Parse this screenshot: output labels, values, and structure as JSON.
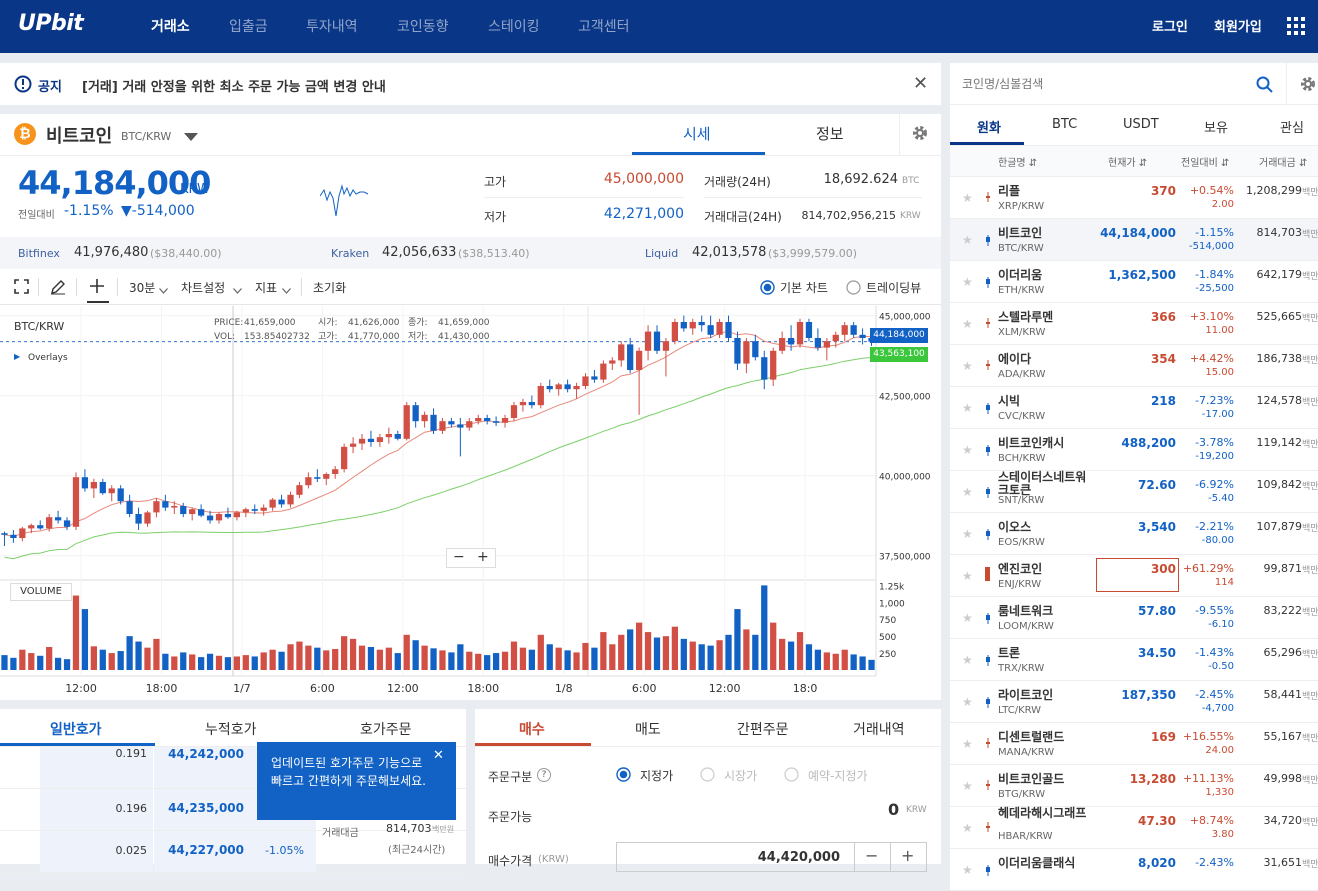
{
  "header": {
    "logo": "UPbit",
    "nav": [
      "거래소",
      "입출금",
      "투자내역",
      "코인동향",
      "스테이킹",
      "고객센터"
    ],
    "login": "로그인",
    "signup": "회원가입"
  },
  "notice": {
    "label": "공지",
    "text": "[거래] 거래 안정을 위한 최소 주문 가능 금액 변경 안내"
  },
  "coin": {
    "name": "비트코인",
    "pair": "BTC/KRW",
    "tab_price": "시세",
    "tab_info": "정보",
    "price": "44,184,000",
    "currency": "KRW",
    "prev_label": "전일대비",
    "change_pct": "-1.15%",
    "change_val": "▼-514,000",
    "high_label": "고가",
    "high": "45,000,000",
    "low_label": "저가",
    "low": "42,271,000",
    "vol_label": "거래량(24H)",
    "vol": "18,692.624",
    "vol_unit": "BTC",
    "amt_label": "거래대금(24H)",
    "amt": "814,702,956,215",
    "amt_unit": "KRW"
  },
  "exchanges": [
    {
      "name": "Bitfinex",
      "price": "41,976,480",
      "usd": "($38,440.00)"
    },
    {
      "name": "Kraken",
      "price": "42,056,633",
      "usd": "($38,513.40)"
    },
    {
      "name": "Liquid",
      "price": "42,013,578",
      "usd": "($3,999,579.00)"
    }
  ],
  "chart_toolbar": {
    "interval": "30분",
    "settings": "차트설정",
    "indicator": "지표",
    "reset": "초기화",
    "basic_chart": "기본 차트",
    "tradingview": "트레이딩뷰"
  },
  "chart_info": {
    "symbol": "BTC/KRW",
    "overlays": "Overlays",
    "price_label": "PRICE:",
    "price_val": "41,659,000",
    "vol_label": "VOL:",
    "vol_val": "153.85402732",
    "open_label": "시가:",
    "open_val": "41,626,000",
    "high_label": "고가:",
    "high_val": "41,770,000",
    "close_label": "종가:",
    "close_val": "41,659,000",
    "low_label": "저가:",
    "low_val": "41,430,000",
    "volume_label": "VOLUME",
    "cur_price_tag": "44,184,000",
    "ma_tag": "43,563,100"
  },
  "chart_data": {
    "type": "candlestick",
    "y_ticks": [
      "45,000,000",
      "42,500,000",
      "40,000,000",
      "37,500,000"
    ],
    "vol_ticks": [
      "1.25k",
      "1,000",
      "750",
      "500",
      "250"
    ],
    "x_ticks": [
      "12:00",
      "18:00",
      "1/7",
      "6:00",
      "12:00",
      "18:00",
      "1/8",
      "6:00",
      "12:00",
      "18:0"
    ],
    "ylim": [
      36800000,
      45300000
    ],
    "vol_max": 1300,
    "candles": [
      [
        38200000,
        38250000,
        37800000,
        38150000,
        220
      ],
      [
        38150000,
        38300000,
        37900000,
        38050000,
        180
      ],
      [
        38050000,
        38400000,
        37950000,
        38350000,
        300
      ],
      [
        38350000,
        38500000,
        38200000,
        38450000,
        250
      ],
      [
        38450000,
        38600000,
        38300000,
        38350000,
        210
      ],
      [
        38350000,
        38800000,
        38250000,
        38700000,
        340
      ],
      [
        38700000,
        38900000,
        38500000,
        38600000,
        180
      ],
      [
        38600000,
        38700000,
        38300000,
        38400000,
        160
      ],
      [
        38400000,
        40100000,
        38300000,
        39950000,
        1100
      ],
      [
        39950000,
        40200000,
        39500000,
        39600000,
        900
      ],
      [
        39600000,
        39900000,
        39300000,
        39800000,
        350
      ],
      [
        39800000,
        39900000,
        39400000,
        39450000,
        300
      ],
      [
        39450000,
        39700000,
        39200000,
        39600000,
        250
      ],
      [
        39600000,
        39700000,
        39100000,
        39200000,
        280
      ],
      [
        39200000,
        39400000,
        38700000,
        38800000,
        500
      ],
      [
        38800000,
        39000000,
        38300000,
        38500000,
        420
      ],
      [
        38500000,
        38900000,
        38400000,
        38850000,
        330
      ],
      [
        38850000,
        39300000,
        38700000,
        39200000,
        460
      ],
      [
        39200000,
        39400000,
        38900000,
        39000000,
        240
      ],
      [
        39000000,
        39200000,
        38800000,
        39050000,
        200
      ],
      [
        39050000,
        39150000,
        38700000,
        38800000,
        260
      ],
      [
        38800000,
        39000000,
        38600000,
        38950000,
        230
      ],
      [
        38950000,
        39100000,
        38700000,
        38750000,
        190
      ],
      [
        38750000,
        38900000,
        38500000,
        38600000,
        240
      ],
      [
        38600000,
        38850000,
        38500000,
        38800000,
        210
      ],
      [
        38800000,
        39000000,
        38650000,
        38700000,
        190
      ],
      [
        38700000,
        38900000,
        38600000,
        38850000,
        200
      ],
      [
        38850000,
        39000000,
        38700000,
        38950000,
        220
      ],
      [
        38950000,
        39100000,
        38800000,
        38900000,
        200
      ],
      [
        38900000,
        39100000,
        38750000,
        39000000,
        260
      ],
      [
        39000000,
        39300000,
        38900000,
        39250000,
        300
      ],
      [
        39250000,
        39400000,
        39000000,
        39100000,
        270
      ],
      [
        39100000,
        39500000,
        39000000,
        39400000,
        380
      ],
      [
        39400000,
        39800000,
        39300000,
        39700000,
        420
      ],
      [
        39700000,
        40100000,
        39600000,
        39950000,
        360
      ],
      [
        39950000,
        40200000,
        39800000,
        39900000,
        330
      ],
      [
        39900000,
        40100000,
        39700000,
        40050000,
        290
      ],
      [
        40050000,
        40300000,
        39900000,
        40200000,
        310
      ],
      [
        40200000,
        41000000,
        40100000,
        40900000,
        500
      ],
      [
        40900000,
        41200000,
        40700000,
        41000000,
        460
      ],
      [
        41000000,
        41300000,
        40800000,
        41150000,
        360
      ],
      [
        41150000,
        41400000,
        40900000,
        41050000,
        340
      ],
      [
        41050000,
        41300000,
        40900000,
        41200000,
        300
      ],
      [
        41200000,
        41500000,
        41000000,
        41300000,
        330
      ],
      [
        41300000,
        41400000,
        41100000,
        41150000,
        250
      ],
      [
        41150000,
        42300000,
        41100000,
        42200000,
        520
      ],
      [
        42200000,
        42300000,
        41500000,
        41700000,
        440
      ],
      [
        41700000,
        42000000,
        41500000,
        41900000,
        360
      ],
      [
        41900000,
        42100000,
        41300000,
        41400000,
        320
      ],
      [
        41400000,
        41800000,
        41300000,
        41700000,
        290
      ],
      [
        41700000,
        41800000,
        41500000,
        41600000,
        260
      ],
      [
        41600000,
        41800000,
        40600000,
        41500000,
        380
      ],
      [
        41500000,
        41800000,
        41400000,
        41700000,
        270
      ],
      [
        41700000,
        41900000,
        41600000,
        41800000,
        240
      ],
      [
        41800000,
        41900000,
        41600000,
        41700000,
        220
      ],
      [
        41700000,
        41850000,
        41550000,
        41650000,
        250
      ],
      [
        41650000,
        41900000,
        41500000,
        41800000,
        270
      ],
      [
        41800000,
        42300000,
        41700000,
        42200000,
        420
      ],
      [
        42200000,
        42400000,
        42000000,
        42300000,
        330
      ],
      [
        42300000,
        42500000,
        42100000,
        42200000,
        300
      ],
      [
        42200000,
        42900000,
        42100000,
        42800000,
        520
      ],
      [
        42800000,
        43000000,
        42600000,
        42700000,
        380
      ],
      [
        42700000,
        42900000,
        42500000,
        42850000,
        330
      ],
      [
        42850000,
        43000000,
        42600000,
        42700000,
        290
      ],
      [
        42700000,
        42900000,
        42400000,
        42800000,
        260
      ],
      [
        42800000,
        43200000,
        42700000,
        43100000,
        400
      ],
      [
        43100000,
        43300000,
        42900000,
        43000000,
        330
      ],
      [
        43000000,
        43600000,
        42900000,
        43500000,
        560
      ],
      [
        43500000,
        43700000,
        43300000,
        43600000,
        380
      ],
      [
        43600000,
        44200000,
        43400000,
        44100000,
        520
      ],
      [
        44100000,
        44300000,
        43200000,
        43300000,
        600
      ],
      [
        43300000,
        44000000,
        41900000,
        43900000,
        700
      ],
      [
        43900000,
        44700000,
        43600000,
        44500000,
        560
      ],
      [
        44500000,
        44700000,
        43800000,
        43900000,
        480
      ],
      [
        43900000,
        44300000,
        43100000,
        44200000,
        500
      ],
      [
        44200000,
        44900000,
        44100000,
        44800000,
        640
      ],
      [
        44800000,
        45000000,
        44500000,
        44600000,
        460
      ],
      [
        44600000,
        44900000,
        44400000,
        44800000,
        420
      ],
      [
        44800000,
        45000000,
        44500000,
        44700000,
        380
      ],
      [
        44700000,
        45000000,
        44300000,
        44400000,
        360
      ],
      [
        44400000,
        44900000,
        44300000,
        44800000,
        440
      ],
      [
        44800000,
        45000000,
        44200000,
        44300000,
        520
      ],
      [
        44300000,
        44500000,
        43300000,
        43500000,
        900
      ],
      [
        43500000,
        44300000,
        43200000,
        44200000,
        600
      ],
      [
        44200000,
        44400000,
        43600000,
        43700000,
        520
      ],
      [
        43700000,
        43900000,
        42700000,
        43000000,
        1250
      ],
      [
        43000000,
        44000000,
        42800000,
        43900000,
        700
      ],
      [
        43900000,
        44500000,
        43800000,
        44300000,
        460
      ],
      [
        44300000,
        44700000,
        43900000,
        44100000,
        420
      ],
      [
        44100000,
        44900000,
        44000000,
        44800000,
        560
      ],
      [
        44800000,
        44900000,
        44200000,
        44300000,
        380
      ],
      [
        44300000,
        44600000,
        43900000,
        44000000,
        300
      ],
      [
        44000000,
        44300000,
        43600000,
        44200000,
        260
      ],
      [
        44200000,
        44500000,
        44000000,
        44400000,
        240
      ],
      [
        44400000,
        44800000,
        44200000,
        44700000,
        300
      ],
      [
        44700000,
        44800000,
        44300000,
        44400000,
        230
      ],
      [
        44400000,
        44600000,
        44100000,
        44300000,
        200
      ],
      [
        44300000,
        44400000,
        44050000,
        44184000,
        150
      ]
    ]
  },
  "market": {
    "search_placeholder": "코인명/심볼검색",
    "tabs": [
      "원화",
      "BTC",
      "USDT",
      "보유",
      "관심"
    ],
    "headers": [
      "한글명 ⇵",
      "현재가 ⇵",
      "전일대비 ⇵",
      "거래대금 ⇵"
    ],
    "unit": "백만",
    "rows": [
      {
        "name": "리플",
        "ticker": "XRP/KRW",
        "price": "370",
        "pct": "+0.54%",
        "diff": "2.00",
        "vol": "1,208,299",
        "up": true
      },
      {
        "name": "비트코인",
        "ticker": "BTC/KRW",
        "price": "44,184,000",
        "pct": "-1.15%",
        "diff": "-514,000",
        "vol": "814,703",
        "up": false
      },
      {
        "name": "이더리움",
        "ticker": "ETH/KRW",
        "price": "1,362,500",
        "pct": "-1.84%",
        "diff": "-25,500",
        "vol": "642,179",
        "up": false
      },
      {
        "name": "스텔라루멘",
        "ticker": "XLM/KRW",
        "price": "366",
        "pct": "+3.10%",
        "diff": "11.00",
        "vol": "525,665",
        "up": true
      },
      {
        "name": "에이다",
        "ticker": "ADA/KRW",
        "price": "354",
        "pct": "+4.42%",
        "diff": "15.00",
        "vol": "186,738",
        "up": true
      },
      {
        "name": "시빅",
        "ticker": "CVC/KRW",
        "price": "218",
        "pct": "-7.23%",
        "diff": "-17.00",
        "vol": "124,578",
        "up": false
      },
      {
        "name": "비트코인캐시",
        "ticker": "BCH/KRW",
        "price": "488,200",
        "pct": "-3.78%",
        "diff": "-19,200",
        "vol": "119,142",
        "up": false
      },
      {
        "name": "스테이터스네트워크토큰",
        "ticker": "SNT/KRW",
        "price": "72.60",
        "pct": "-6.92%",
        "diff": "-5.40",
        "vol": "109,842",
        "up": false
      },
      {
        "name": "이오스",
        "ticker": "EOS/KRW",
        "price": "3,540",
        "pct": "-2.21%",
        "diff": "-80.00",
        "vol": "107,879",
        "up": false
      },
      {
        "name": "엔진코인",
        "ticker": "ENJ/KRW",
        "price": "300",
        "pct": "+61.29%",
        "diff": "114",
        "vol": "99,871",
        "up": true
      },
      {
        "name": "룸네트워크",
        "ticker": "LOOM/KRW",
        "price": "57.80",
        "pct": "-9.55%",
        "diff": "-6.10",
        "vol": "83,222",
        "up": false
      },
      {
        "name": "트론",
        "ticker": "TRX/KRW",
        "price": "34.50",
        "pct": "-1.43%",
        "diff": "-0.50",
        "vol": "65,296",
        "up": false
      },
      {
        "name": "라이트코인",
        "ticker": "LTC/KRW",
        "price": "187,350",
        "pct": "-2.45%",
        "diff": "-4,700",
        "vol": "58,441",
        "up": false
      },
      {
        "name": "디센트럴랜드",
        "ticker": "MANA/KRW",
        "price": "169",
        "pct": "+16.55%",
        "diff": "24.00",
        "vol": "55,167",
        "up": true
      },
      {
        "name": "비트코인골드",
        "ticker": "BTG/KRW",
        "price": "13,280",
        "pct": "+11.13%",
        "diff": "1,330",
        "vol": "49,998",
        "up": true
      },
      {
        "name": "헤데라해시그래프",
        "ticker": "HBAR/KRW",
        "price": "47.30",
        "pct": "+8.74%",
        "diff": "3.80",
        "vol": "34,720",
        "up": true
      },
      {
        "name": "이더리움클래식",
        "ticker": "",
        "price": "8,020",
        "pct": "-2.43%",
        "diff": "",
        "vol": "31,651",
        "up": false
      }
    ]
  },
  "orderbook": {
    "tabs": [
      "일반호가",
      "누적호가",
      "호가주문"
    ],
    "rows": [
      {
        "qty": "0.191",
        "price": "44,242,000",
        "pct": ""
      },
      {
        "qty": "0.196",
        "price": "44,235,000",
        "pct": ""
      },
      {
        "qty": "0.025",
        "price": "44,227,000",
        "pct": "-1.05%"
      }
    ],
    "amt_label": "거래대금",
    "amt_val": "814,703",
    "amt_unit": "백만원",
    "amt_note": "(최근24시간)",
    "tooltip": "업데이트된 호가주문 기능으로 빠르고 간편하게 주문해보세요."
  },
  "order": {
    "tabs": [
      "매수",
      "매도",
      "간편주문",
      "거래내역"
    ],
    "type_label": "주문구분",
    "types": [
      "지정가",
      "시장가",
      "예약-지정가"
    ],
    "avail_label": "주문가능",
    "avail_val": "0",
    "avail_unit": "KRW",
    "price_label": "매수가격",
    "price_unit": "(KRW)",
    "price_val": "44,420,000"
  }
}
